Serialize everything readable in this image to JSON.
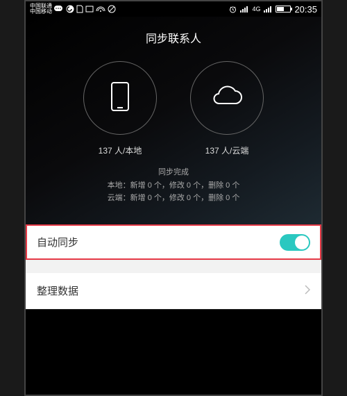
{
  "statusbar": {
    "carrier1": "中国联通",
    "carrier2": "中国移动",
    "network": "4G",
    "time": "20:35"
  },
  "title": "同步联系人",
  "local": {
    "label": "137 人/本地"
  },
  "cloud": {
    "label": "137 人/云端"
  },
  "sync_status": {
    "line1": "同步完成",
    "line2": "本地：新增 0 个，修改 0 个，删除 0 个",
    "line3": "云端：新增 0 个，修改 0 个，删除 0 个"
  },
  "settings": {
    "auto_sync": "自动同步",
    "organize": "整理数据"
  }
}
